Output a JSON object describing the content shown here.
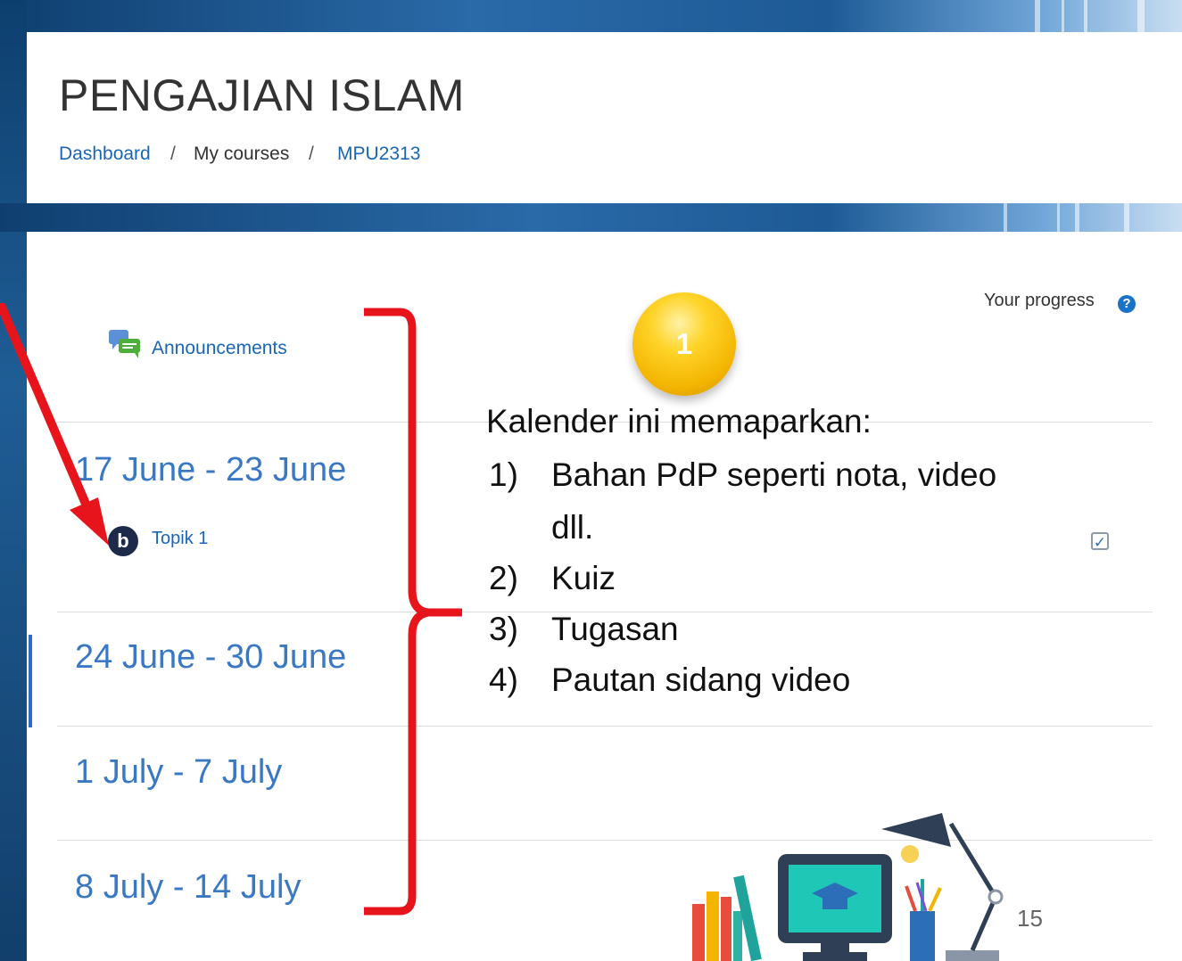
{
  "course": {
    "title": "PENGAJIAN ISLAM"
  },
  "breadcrumb": {
    "items": [
      "Dashboard",
      "My courses",
      "MPU2313"
    ],
    "separator": "/"
  },
  "progress": {
    "label": "Your progress",
    "help_icon": "question-circle-icon"
  },
  "sections": {
    "announcements": {
      "label": "Announcements",
      "icon": "forum-chat-icon"
    },
    "weeks": [
      {
        "label": "17 June - 23 June",
        "activity": {
          "label": "Topik 1",
          "icon": "bigbluebutton-icon",
          "completed": true
        }
      },
      {
        "label": "24 June - 30 June"
      },
      {
        "label": "1 July - 7 July"
      },
      {
        "label": "8 July - 14 July"
      }
    ]
  },
  "annotation": {
    "badge_number": "1",
    "intro": "Kalender ini memaparkan:",
    "items": [
      {
        "num": "1)",
        "line1": "Bahan PdP seperti nota, video",
        "line2": "dll."
      },
      {
        "num": "2)",
        "line1": "Kuiz"
      },
      {
        "num": "3)",
        "line1": "Tugasan"
      },
      {
        "num": "4)",
        "line1": "Pautan sidang video"
      }
    ],
    "arrow_color": "#e8141b",
    "brace_color": "#e8141b"
  },
  "slide": {
    "number": "15"
  },
  "colors": {
    "frame_blue": "#1f5d95",
    "link_blue": "#1a66b5",
    "badge_gold": "#f3b400"
  }
}
